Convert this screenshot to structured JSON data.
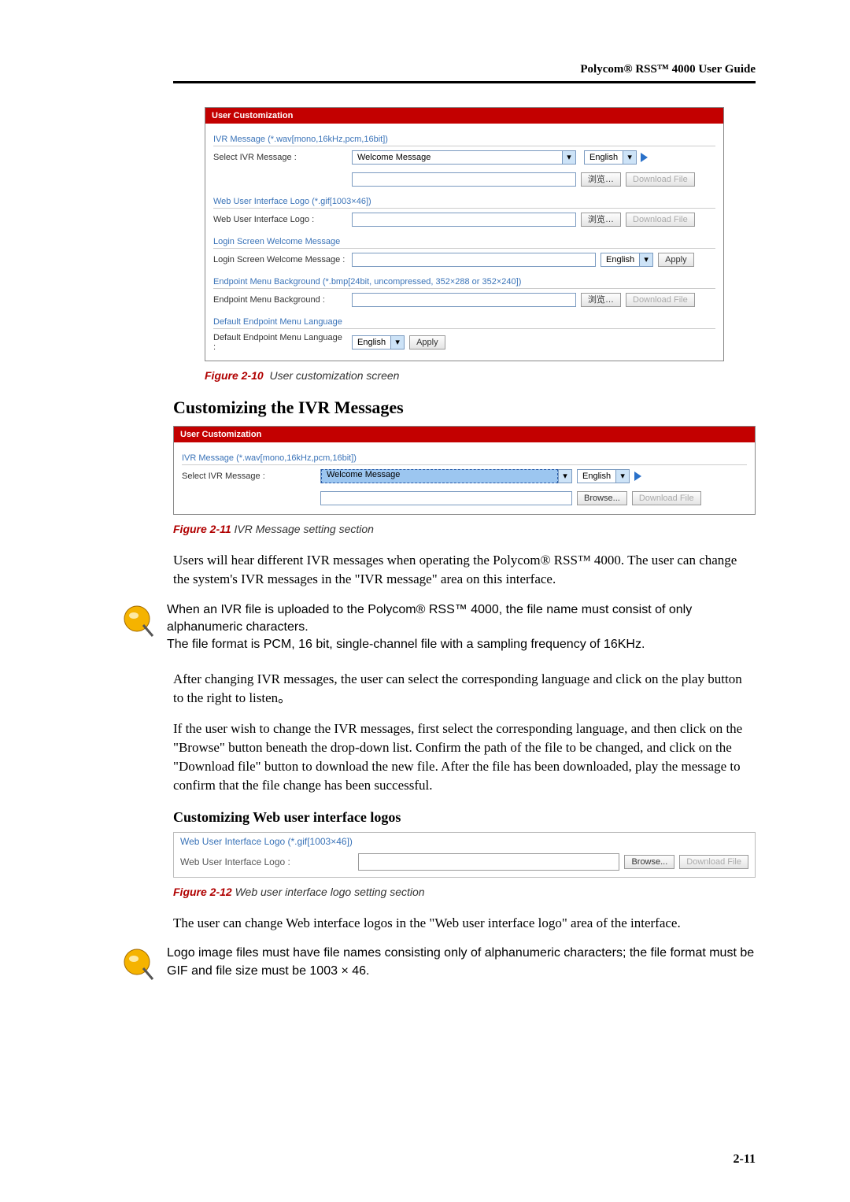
{
  "header": "Polycom® RSS™ 4000 User Guide",
  "screenshot1": {
    "panel_title": "User Customization",
    "sec_ivr": "IVR Message (*.wav[mono,16kHz,pcm,16bit])",
    "lbl_select_ivr": "Select IVR Message :",
    "val_welcome": "Welcome Message",
    "english": "English",
    "browse_cn": "浏览…",
    "download": "Download File",
    "sec_logo": "Web User Interface Logo (*.gif[1003×46])",
    "lbl_logo": "Web User Interface Logo :",
    "sec_login": "Login Screen Welcome Message",
    "lbl_login": "Login Screen Welcome Message :",
    "apply": "Apply",
    "sec_bg": "Endpoint Menu Background (*.bmp[24bit, uncompressed, 352×288 or 352×240])",
    "lbl_bg": "Endpoint Menu Background :",
    "sec_lang": "Default Endpoint Menu Language",
    "lbl_lang": "Default Endpoint Menu Language :"
  },
  "caption1": {
    "num": "Figure 2-10",
    "title": "User customization screen"
  },
  "heading1": "Customizing the IVR Messages",
  "screenshot2": {
    "panel_title": "User Customization",
    "sec_ivr": "IVR Message (*.wav[mono,16kHz,pcm,16bit])",
    "lbl_select_ivr": "Select IVR Message :",
    "val_welcome": "Welcome Message",
    "english": "English",
    "browse": "Browse...",
    "download": "Download File"
  },
  "caption2": {
    "num": "Figure 2-11",
    "title": "IVR Message setting section"
  },
  "para1": "Users will hear different IVR messages when operating the Polycom® RSS™ 4000. The user can change the system's IVR messages in the \"IVR message\" area on this interface.",
  "note1a": "When an IVR file is uploaded to the Polycom® RSS™ 4000, the file name must consist of only alphanumeric characters.",
  "note1b": "The file format is PCM, 16 bit, single-channel file with a sampling frequency of 16KHz.",
  "para2": "After changing IVR messages, the user can select the corresponding language and click on the play button to the right to listen。",
  "para3": "If the user wish to change the IVR messages, first select the corresponding language, and then click on the \"Browse\" button beneath the drop-down list. Confirm the path of the file to be changed, and click on the \"Download file\" button to download the new file. After the file has been downloaded, play the message to confirm that the file change has been successful.",
  "heading2": "Customizing Web user interface logos",
  "logosec": {
    "row1": "Web User Interface Logo (*.gif[1003×46])",
    "lbl": "Web User Interface Logo :",
    "browse": "Browse...",
    "download": "Download File"
  },
  "caption3": {
    "num": "Figure 2-12",
    "title": "Web user interface logo setting section"
  },
  "para4": "The user can change Web interface logos in the \"Web user interface logo\" area of the interface.",
  "note2": "Logo image files must have file names consisting only of alphanumeric characters; the file format must be GIF and file size must be 1003 × 46.",
  "page_num": "2-11"
}
